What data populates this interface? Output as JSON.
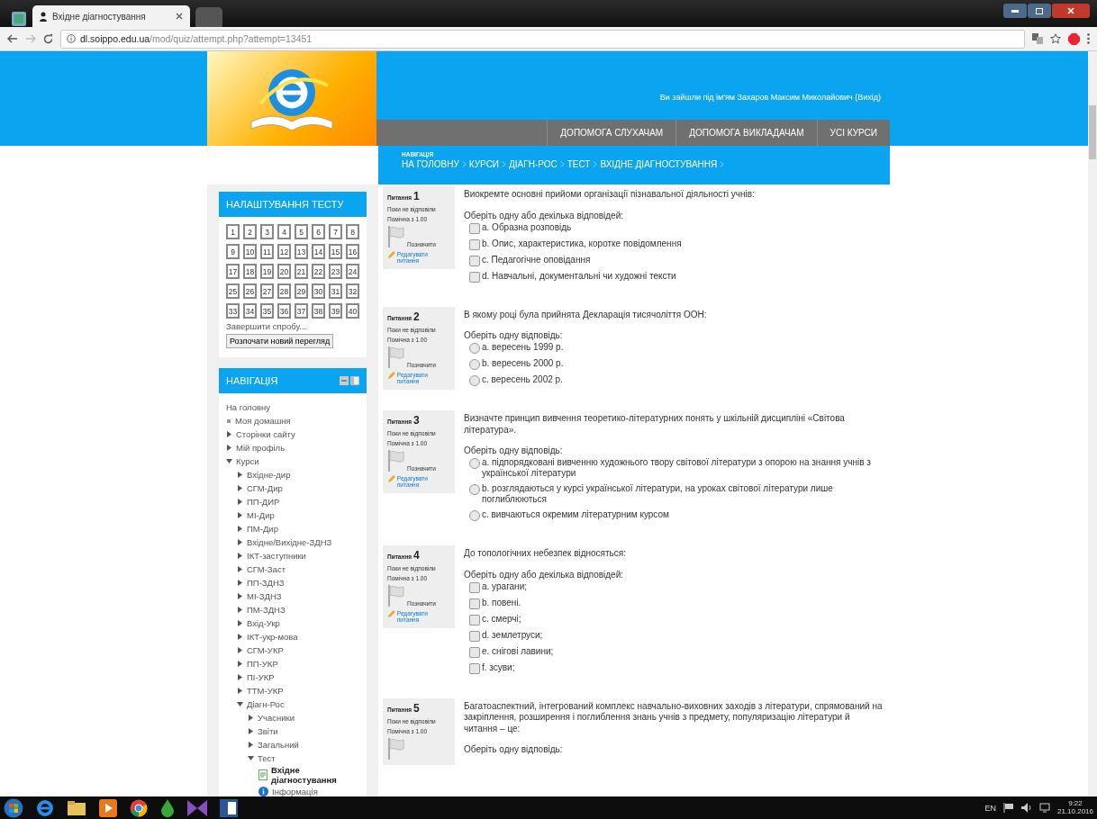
{
  "browser": {
    "tab_title": "Вхідне діагностування",
    "url_host": "dl.soippo.edu.ua",
    "url_path": "/mod/quiz/attempt.php?attempt=13451"
  },
  "header": {
    "user_text": "Ви зайшли під ім'ям Захаров Максим Миколайович (Вихід)",
    "menu": [
      "ДОПОМОГА СЛУХАЧАМ",
      "ДОПОМОГА ВИКЛАДАЧАМ",
      "УСІ КУРСИ"
    ]
  },
  "breadcrumb": {
    "label": "НАВІГАЦІЯ",
    "items": [
      "НА ГОЛОВНУ",
      "КУРСИ",
      "ДІАГН-РОС",
      "ТЕСТ",
      "ВХІДНЕ ДІАГНОСТУВАННЯ"
    ]
  },
  "quiz_block": {
    "title": "НАЛАШТУВАННЯ ТЕСТУ",
    "buttons": [
      "1",
      "2",
      "3",
      "4",
      "5",
      "6",
      "7",
      "8",
      "9",
      "10",
      "11",
      "12",
      "13",
      "14",
      "15",
      "16",
      "17",
      "18",
      "19",
      "20",
      "21",
      "22",
      "23",
      "24",
      "25",
      "26",
      "27",
      "28",
      "29",
      "30",
      "31",
      "32",
      "33",
      "34",
      "35",
      "36",
      "37",
      "38",
      "39",
      "40"
    ],
    "finish_link": "Завершити спробу...",
    "new_preview": "Розпочати новий перегляд"
  },
  "nav": {
    "title": "НАВІГАЦІЯ",
    "items": [
      {
        "label": "На головну",
        "kind": "link"
      },
      {
        "label": "Моя домашня",
        "kind": "bullet"
      },
      {
        "label": "Сторінки сайту",
        "kind": "branch",
        "expanded": false
      },
      {
        "label": "Мій профіль",
        "kind": "branch",
        "expanded": false
      },
      {
        "label": "Курси",
        "kind": "branch",
        "expanded": true,
        "children": [
          {
            "label": "Вхідне-дир",
            "kind": "branch",
            "expanded": false
          },
          {
            "label": "СГМ-Дир",
            "kind": "branch",
            "expanded": false
          },
          {
            "label": "ПП-ДИР",
            "kind": "branch",
            "expanded": false
          },
          {
            "label": "МІ-Дир",
            "kind": "branch",
            "expanded": false
          },
          {
            "label": "ПМ-Дир",
            "kind": "branch",
            "expanded": false
          },
          {
            "label": "Вхідне/Вихідне-ЗДНЗ",
            "kind": "branch",
            "expanded": false
          },
          {
            "label": "ІКТ-заступники",
            "kind": "branch",
            "expanded": false
          },
          {
            "label": "СГМ-Заст",
            "kind": "branch",
            "expanded": false
          },
          {
            "label": "ПП-ЗДНЗ",
            "kind": "branch",
            "expanded": false
          },
          {
            "label": "МІ-ЗДНЗ",
            "kind": "branch",
            "expanded": false
          },
          {
            "label": "ПМ-ЗДНЗ",
            "kind": "branch",
            "expanded": false
          },
          {
            "label": "Вхід-Укр",
            "kind": "branch",
            "expanded": false
          },
          {
            "label": "ІКТ-укр-мова",
            "kind": "branch",
            "expanded": false
          },
          {
            "label": "СГМ-УКР",
            "kind": "branch",
            "expanded": false
          },
          {
            "label": "ПП-УКР",
            "kind": "branch",
            "expanded": false
          },
          {
            "label": "ПІ-УКР",
            "kind": "branch",
            "expanded": false
          },
          {
            "label": "ТТМ-УКР",
            "kind": "branch",
            "expanded": false
          },
          {
            "label": "Діагн-Рос",
            "kind": "branch",
            "expanded": true,
            "children": [
              {
                "label": "Учасники",
                "kind": "branch",
                "expanded": false
              },
              {
                "label": "Звіти",
                "kind": "branch",
                "expanded": false
              },
              {
                "label": "Загальний",
                "kind": "branch",
                "expanded": false
              },
              {
                "label": "Тест",
                "kind": "branch",
                "expanded": true,
                "children": [
                  {
                    "label": "Вхідне діагностування",
                    "kind": "current"
                  },
                  {
                    "label": "Інформація",
                    "kind": "info"
                  }
                ]
              }
            ]
          }
        ]
      }
    ]
  },
  "questions": [
    {
      "label": "Питання",
      "number": "1",
      "status": "Поки не відповіли",
      "mark": "Помічна з 1.00",
      "flag_label": "Позначити",
      "edit_link": "Редагувати питання",
      "text": "Виокремте основні прийоми організації пізнавальної діяльності учнів:",
      "prompt": "Оберіть одну або декілька відповідей:",
      "kind": "checkbox",
      "options": [
        {
          "text": "a. Образна розповідь",
          "checked": false
        },
        {
          "text": "b. Опис, характеристика, коротке повідомлення",
          "checked": false
        },
        {
          "text": "c. Педагогічне оповідання",
          "checked": false
        },
        {
          "text": "d. Навчальні, документальні чи художні тексти",
          "checked": false
        }
      ]
    },
    {
      "label": "Питання",
      "number": "2",
      "status": "Поки не відповіли",
      "mark": "Помічна з 1.00",
      "flag_label": "Позначити",
      "edit_link": "Редагувати питання",
      "text": "В якому році була прийнята Декларація тисячоліття ООН:",
      "prompt": "Оберіть одну відповідь:",
      "kind": "radio",
      "options": [
        {
          "text": "a. вересень 1999 р.",
          "checked": false
        },
        {
          "text": "b. вересень 2000 р.",
          "checked": false
        },
        {
          "text": "c. вересень 2002 р.",
          "checked": false
        }
      ]
    },
    {
      "label": "Питання",
      "number": "3",
      "status": "Поки не відповіли",
      "mark": "Помічна з 1.00",
      "flag_label": "Позначити",
      "edit_link": "Редагувати питання",
      "text": "Визначте принцип вивчення теоретико-літературних понять у шкільній дисципліні «Світова література».",
      "prompt": "Оберіть одну відповідь:",
      "kind": "radio",
      "options": [
        {
          "text": "a. підпорядковані вивченню художнього твору світової літератури з опорою на знання учнів  з української літератури",
          "checked": false
        },
        {
          "text": "b. розглядаються у курсі української літератури, на уроках світової літератури лише поглиблюються",
          "checked": false
        },
        {
          "text": "c. вивчаються окремим літературним курсом",
          "checked": false
        }
      ]
    },
    {
      "label": "Питання",
      "number": "4",
      "status": "Поки не відповіли",
      "mark": "Помічна з 1.00",
      "flag_label": "Позначити",
      "edit_link": "Редагувати питання",
      "text": "До топологічних небезпек відносяться:",
      "prompt": "Оберіть одну або декілька відповідей:",
      "kind": "checkbox",
      "options": [
        {
          "text": "a. урагани;",
          "checked": false
        },
        {
          "text": "b. повені.",
          "checked": false
        },
        {
          "text": "c. смерчі;",
          "checked": false
        },
        {
          "text": "d. землетруси;",
          "checked": false
        },
        {
          "text": "e. снігові лавини;",
          "checked": false
        },
        {
          "text": "f. зсуви;",
          "checked": false
        }
      ]
    },
    {
      "label": "Питання",
      "number": "5",
      "status": "Поки не відповіли",
      "mark": "Помічна з 1.00",
      "text": "Багатоаспектний, інтегрований комплекс навчально-виховних заходів з літератури, спрямований на закріплення, розширення і поглиблення знань учнів з предмету, популяризацію літератури й читання – це:",
      "prompt": "Оберіть одну відповідь:",
      "kind": "radio"
    }
  ],
  "taskbar": {
    "language": "EN",
    "time": "9:22",
    "date": "21.10.2016"
  }
}
